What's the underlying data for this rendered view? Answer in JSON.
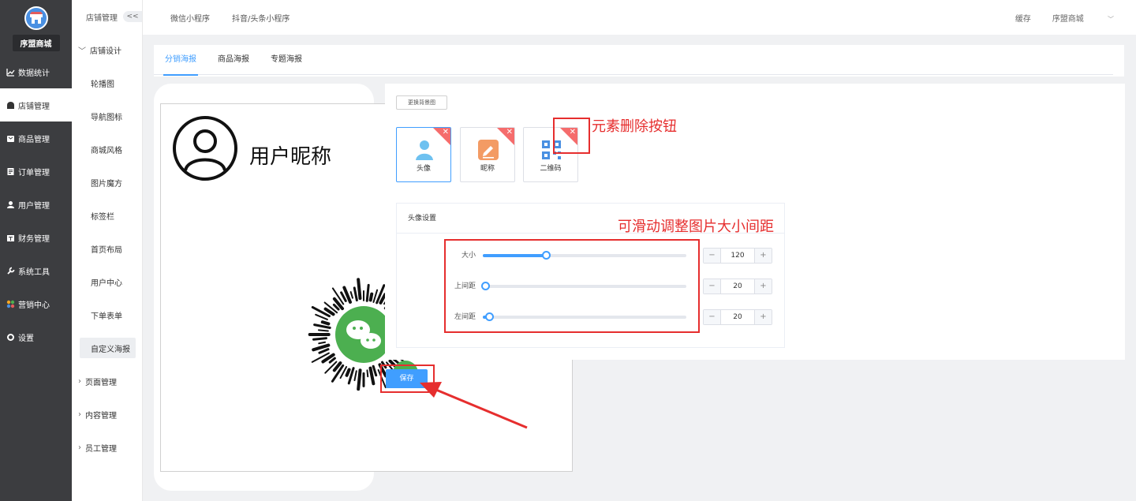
{
  "sidebar": {
    "shop_name": "序盟商城",
    "items": [
      {
        "label": "数据统计",
        "icon": "chart-line-icon"
      },
      {
        "label": "店铺管理",
        "icon": "store-icon"
      },
      {
        "label": "商品管理",
        "icon": "goods-icon"
      },
      {
        "label": "订单管理",
        "icon": "order-icon"
      },
      {
        "label": "用户管理",
        "icon": "user-icon"
      },
      {
        "label": "财务管理",
        "icon": "wallet-icon"
      },
      {
        "label": "系统工具",
        "icon": "wrench-icon"
      },
      {
        "label": "营销中心",
        "icon": "marketing-icon"
      },
      {
        "label": "设置",
        "icon": "gear-icon"
      }
    ]
  },
  "subsidebar": {
    "header": "店铺管理",
    "collapse": "<<",
    "group_design": "店铺设计",
    "design_items": [
      "轮播图",
      "导航图标",
      "商城风格",
      "图片魔方",
      "标签栏",
      "首页布局",
      "用户中心",
      "下单表单",
      "自定义海报"
    ],
    "group_page": "页面管理",
    "group_content": "内容管理",
    "group_staff": "员工管理"
  },
  "topbar": {
    "tabs": [
      "微信小程序",
      "抖音/头条小程序"
    ],
    "cache": "缓存",
    "shop": "序盟商城"
  },
  "content_tabs": [
    "分销海报",
    "商品海报",
    "专题海报"
  ],
  "poster": {
    "nickname": "用户昵称",
    "save": "保存"
  },
  "panel": {
    "bg_button": "更换背景图",
    "elements": [
      {
        "label": "头像",
        "icon": "avatar-icon"
      },
      {
        "label": "昵称",
        "icon": "nickname-icon"
      },
      {
        "label": "二维码",
        "icon": "qrcode-icon"
      }
    ],
    "settings_title": "头像设置",
    "rows": [
      {
        "label": "大小",
        "value": "120",
        "fraction": 0.31
      },
      {
        "label": "上间距",
        "value": "20",
        "fraction": 0.01
      },
      {
        "label": "左间距",
        "value": "20",
        "fraction": 0.03
      }
    ],
    "minus": "−",
    "plus": "+"
  },
  "annotations": {
    "delete_note": "元素删除按钮",
    "slider_note": "可滑动调整图片大小间距"
  },
  "colors": {
    "accent": "#409eff",
    "annotation": "#e62e2e",
    "sidebar_bg": "#3c3d40"
  }
}
